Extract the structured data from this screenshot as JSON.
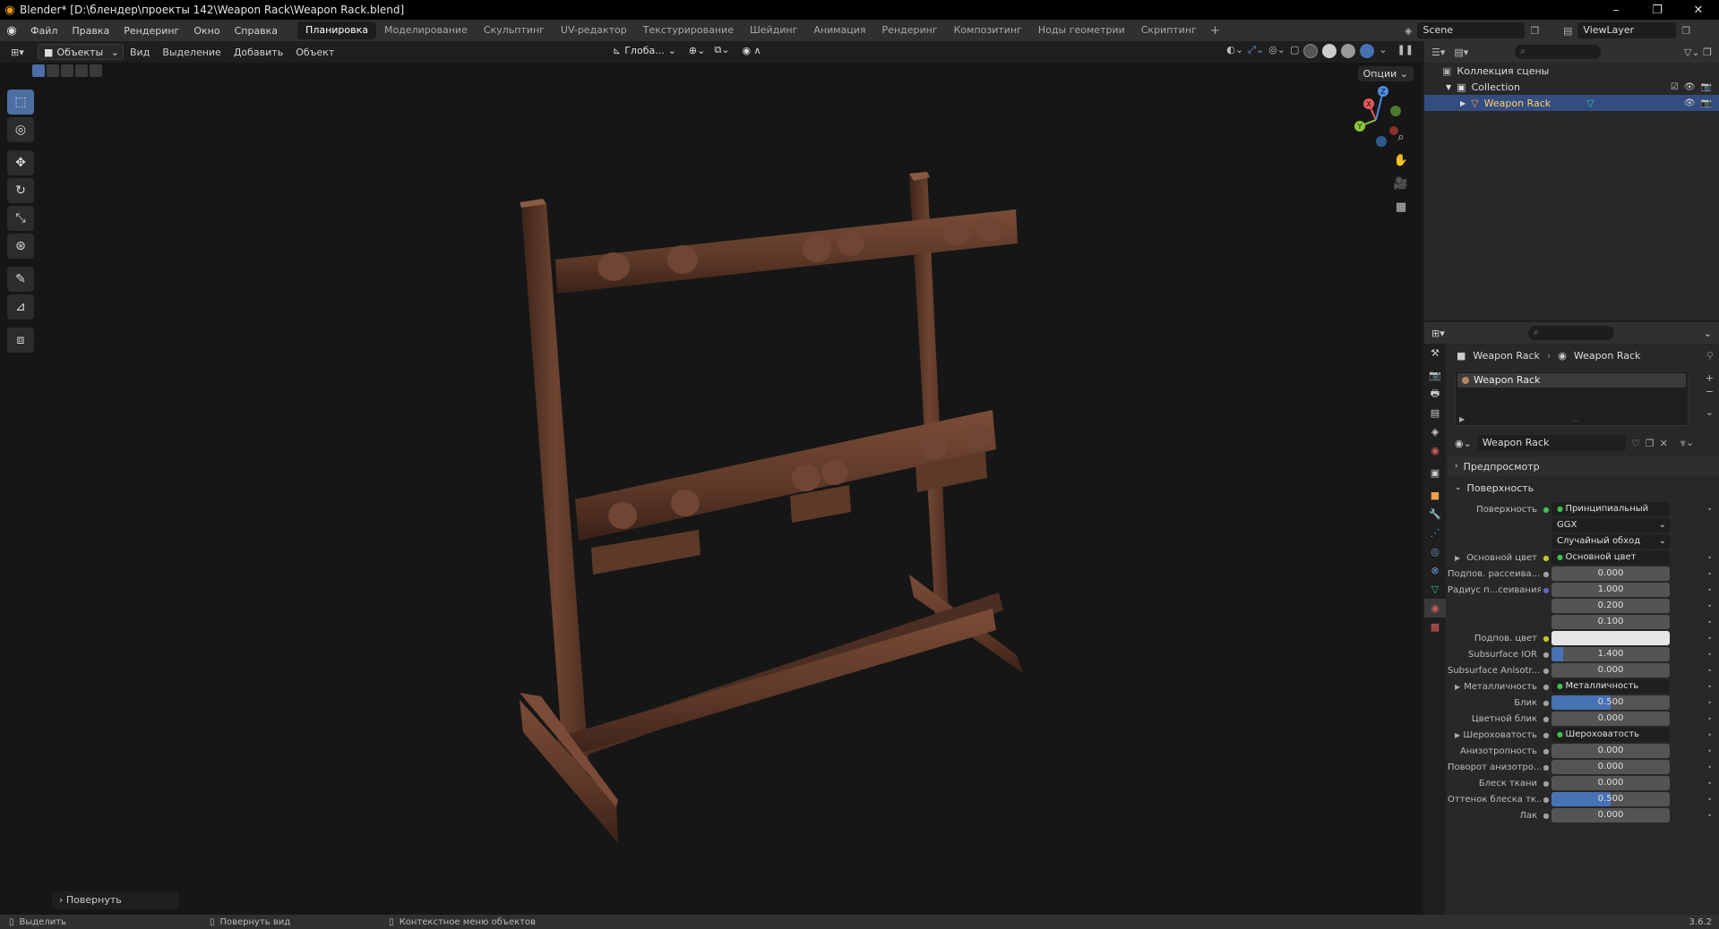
{
  "window": {
    "title": "Blender* [D:\\блендер\\проекты 142\\Weapon Rack\\Weapon Rack.blend]",
    "controls": [
      "–",
      "❐",
      "✕"
    ]
  },
  "menu": {
    "items": [
      "Файл",
      "Правка",
      "Рендеринг",
      "Окно",
      "Справка"
    ],
    "workspaces": [
      "Планировка",
      "Моделирование",
      "Скульптинг",
      "UV-редактор",
      "Текстурирование",
      "Шейдинг",
      "Анимация",
      "Рендеринг",
      "Композитинг",
      "Ноды геометрии",
      "Скриптинг"
    ],
    "active_workspace": "Планировка",
    "scene": "Scene",
    "view_layer": "ViewLayer"
  },
  "viewport": {
    "mode": "Объекты",
    "header_menus": [
      "Вид",
      "Выделение",
      "Добавить",
      "Объект"
    ],
    "orientation": "Глоба...",
    "options": "Опции",
    "last_operator": "Повернуть",
    "gizmo_axes": [
      "X",
      "Y",
      "Z"
    ]
  },
  "statusbar": {
    "select": "Выделить",
    "rotate_view": "Повернуть вид",
    "context_menu": "Контекстное меню объектов",
    "version": "3.6.2"
  },
  "outliner": {
    "search_placeholder": "",
    "root": "Коллекция сцены",
    "collection": "Collection",
    "object": "Weapon Rack"
  },
  "properties": {
    "breadcrumb_object": "Weapon Rack",
    "breadcrumb_material": "Weapon Rack",
    "slot": "Weapon Rack",
    "material_name": "Weapon Rack",
    "preview_panel": "Предпросмотр",
    "surface_panel": "Поверхность",
    "rows": [
      {
        "label": "Поверхность",
        "value": "Принципиальный BSDF",
        "kind": "link",
        "sock": "#3fbf4f"
      },
      {
        "label": "",
        "value": "GGX",
        "kind": "dropdown"
      },
      {
        "label": "",
        "value": "Случайный обход",
        "kind": "dropdown"
      },
      {
        "label": "Основной цвет",
        "value": "Основной цвет",
        "kind": "link",
        "sock": "#c7c729",
        "expand": true
      },
      {
        "label": "Подпов. рассеива...",
        "value": "0.000",
        "kind": "num",
        "sock": "#a1a1a1"
      },
      {
        "label": "Радиус п...сеивания",
        "value": "1.000",
        "kind": "num",
        "sock": "#6363c7"
      },
      {
        "label": "",
        "value": "0.200",
        "kind": "num"
      },
      {
        "label": "",
        "value": "0.100",
        "kind": "num"
      },
      {
        "label": "Подпов. цвет",
        "value": "",
        "kind": "white",
        "sock": "#c7c729"
      },
      {
        "label": "Subsurface IOR",
        "value": "1.400",
        "kind": "num",
        "sock": "#a1a1a1",
        "fill": 0.1
      },
      {
        "label": "Subsurface Anisotr...",
        "value": "0.000",
        "kind": "num",
        "sock": "#a1a1a1"
      },
      {
        "label": "Металличность",
        "value": "Металличность",
        "kind": "link",
        "sock": "#a1a1a1",
        "expand": true
      },
      {
        "label": "Блик",
        "value": "0.500",
        "kind": "num",
        "sock": "#a1a1a1",
        "fill": 0.5
      },
      {
        "label": "Цветной блик",
        "value": "0.000",
        "kind": "num",
        "sock": "#a1a1a1"
      },
      {
        "label": "Шероховатость",
        "value": "Шероховатость",
        "kind": "link",
        "sock": "#a1a1a1",
        "expand": true
      },
      {
        "label": "Анизотропность",
        "value": "0.000",
        "kind": "num",
        "sock": "#a1a1a1"
      },
      {
        "label": "Поворот анизотро...",
        "value": "0.000",
        "kind": "num",
        "sock": "#a1a1a1"
      },
      {
        "label": "Блеск ткани",
        "value": "0.000",
        "kind": "num",
        "sock": "#a1a1a1"
      },
      {
        "label": "Оттенок блеска тк...",
        "value": "0.500",
        "kind": "num",
        "sock": "#a1a1a1",
        "fill": 0.5
      },
      {
        "label": "Лак",
        "value": "0.000",
        "kind": "num",
        "sock": "#a1a1a1"
      }
    ]
  },
  "colors": {
    "accent": "#4772b3",
    "selection": "#334d80",
    "wood_dark": "#4a2c20",
    "wood_light": "#7a4c38"
  }
}
